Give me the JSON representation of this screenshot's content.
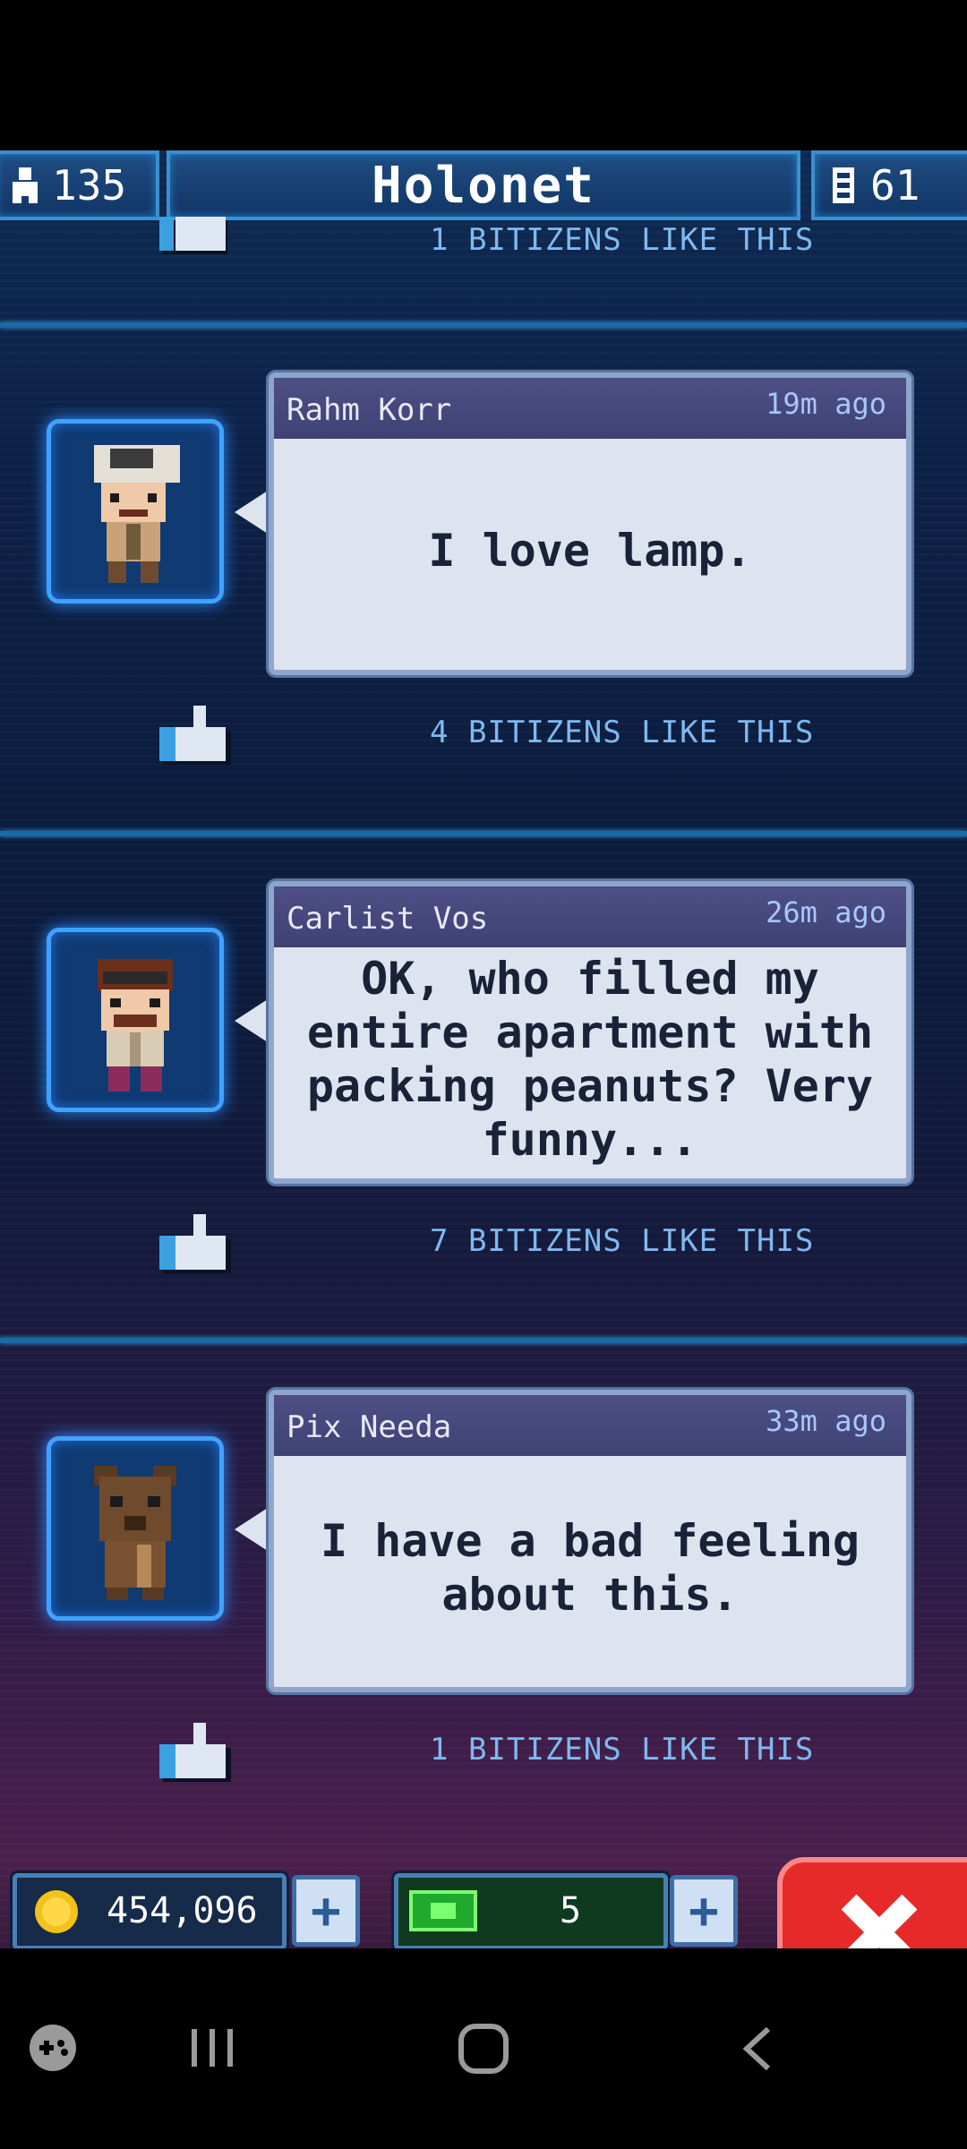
{
  "header": {
    "population": "135",
    "title": "Holonet",
    "floors": "61"
  },
  "top_partial": {
    "likes": "1 BITIZENS LIKE THIS"
  },
  "posts": [
    {
      "author": "Rahm Korr",
      "time": "19m ago",
      "message": "I love lamp.",
      "likes": "4 BITIZENS LIKE THIS"
    },
    {
      "author": "Carlist Vos",
      "time": "26m ago",
      "message": "OK, who filled my entire apartment with packing peanuts? Very funny...",
      "likes": "7 BITIZENS LIKE THIS"
    },
    {
      "author": "Pix Needa",
      "time": "33m ago",
      "message": "I have a bad feeling about this.",
      "likes": "1 BITIZENS LIKE THIS"
    }
  ],
  "bottombar": {
    "coins": "454,096",
    "bux": "5"
  },
  "icons": {
    "population": "person-icon",
    "floors": "floor-icon",
    "like": "thumbs-up-icon",
    "coin": "coin-icon",
    "bux": "bux-icon",
    "close": "close-icon",
    "game_launcher": "gamepad-icon",
    "recents": "recent-apps-icon",
    "home": "home-icon",
    "back": "back-icon"
  },
  "colors": {
    "accent": "#3fa2ff",
    "close": "#e62a2a",
    "like_text": "#7fb9ef"
  }
}
